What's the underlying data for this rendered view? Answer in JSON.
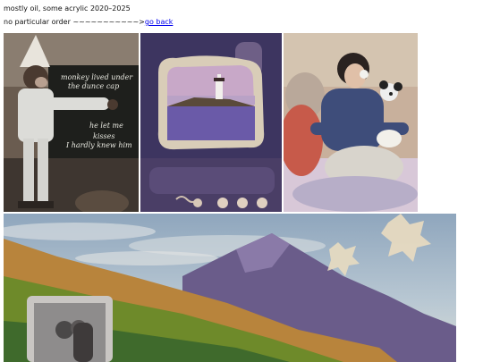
{
  "header": {
    "subtitle": "mostly oil, some acrylic 2020–2025",
    "order_note": "no particular order ~~~~~~~~~~~>",
    "back_link": "go back"
  },
  "paintings": [
    {
      "name": "monkey-dunce-cap-painting",
      "board_lines": [
        "monkey lived under",
        "the dunce cap",
        "he let me",
        "kisses",
        "I hardly knew him"
      ]
    },
    {
      "name": "lighthouse-window-painting"
    },
    {
      "name": "woman-with-dog-painting"
    },
    {
      "name": "mountain-landscape-painting"
    }
  ],
  "colors": {
    "link": "#0000ee",
    "background": "#ffffff"
  }
}
